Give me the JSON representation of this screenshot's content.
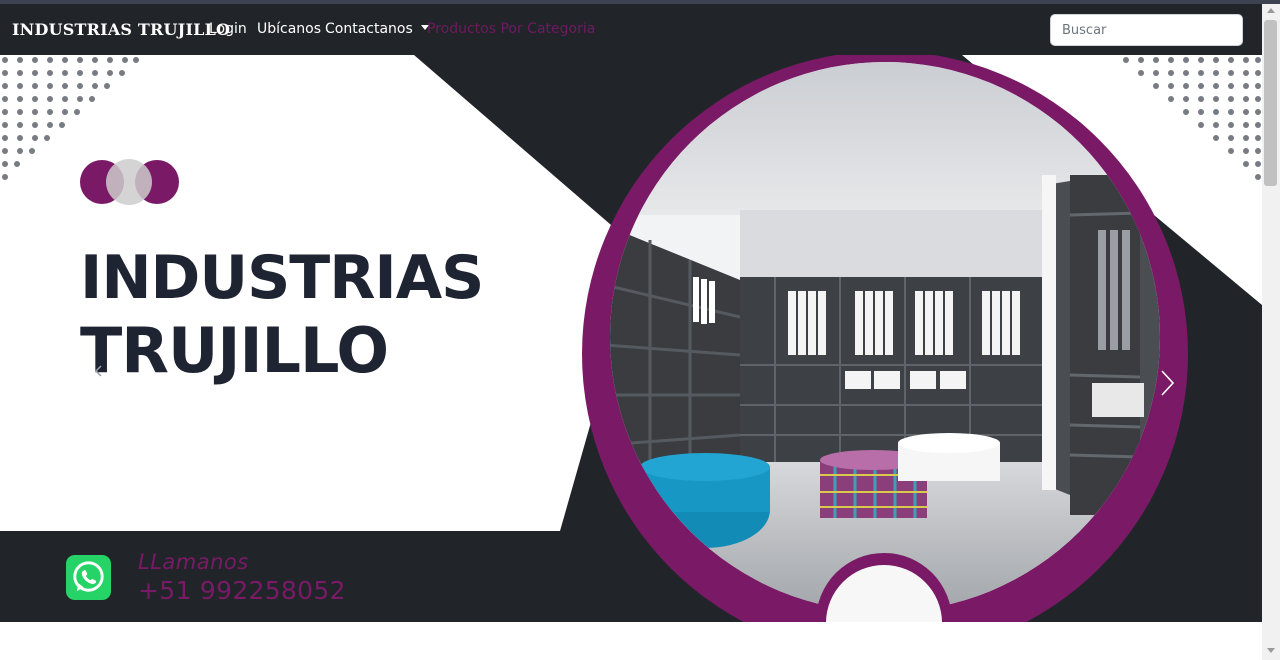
{
  "navbar": {
    "brand": "INDUSTRIAS TRUJILLO",
    "links": {
      "login": "Login",
      "ubicanos": "Ubícanos",
      "contactanos": "Contactanos",
      "productos": "Productos Por Categoria"
    },
    "search_placeholder": "Buscar"
  },
  "hero": {
    "title_line1": "INDUSTRIAS",
    "title_line2": "TRUJILLO",
    "call_label": "LLamanos",
    "phone": "+51 992258052"
  },
  "colors": {
    "navbar_bg": "#212529",
    "accent_purple": "#7a1a66",
    "dark_band": "#212529",
    "title_text": "#1f2433"
  },
  "icons": {
    "whatsapp": "whatsapp-icon",
    "carousel_next": "chevron-right-icon",
    "carousel_prev": "chevron-left-icon"
  }
}
